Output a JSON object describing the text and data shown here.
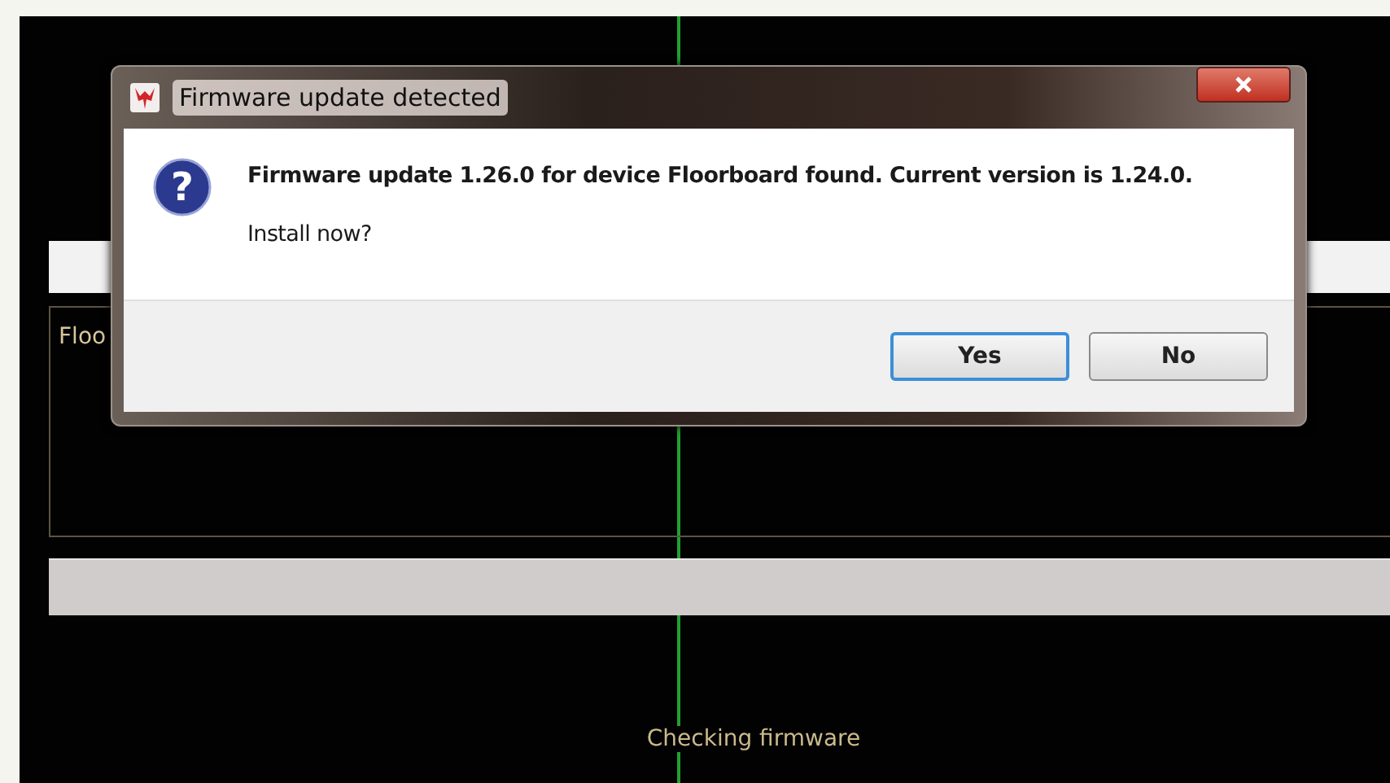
{
  "background_app": {
    "panel_label": "Floo",
    "progress": {
      "level": 1
    },
    "status_text": "Checking firmware"
  },
  "dialog": {
    "title": "Firmware update detected",
    "icon_glyph": "?",
    "message": "Firmware update 1.26.0 for device Floorboard found. Current version is 1.24.0.",
    "question": "Install now?",
    "buttons": [
      {
        "label": "Yes",
        "focused": true
      },
      {
        "label": "No",
        "focused": false
      }
    ]
  }
}
